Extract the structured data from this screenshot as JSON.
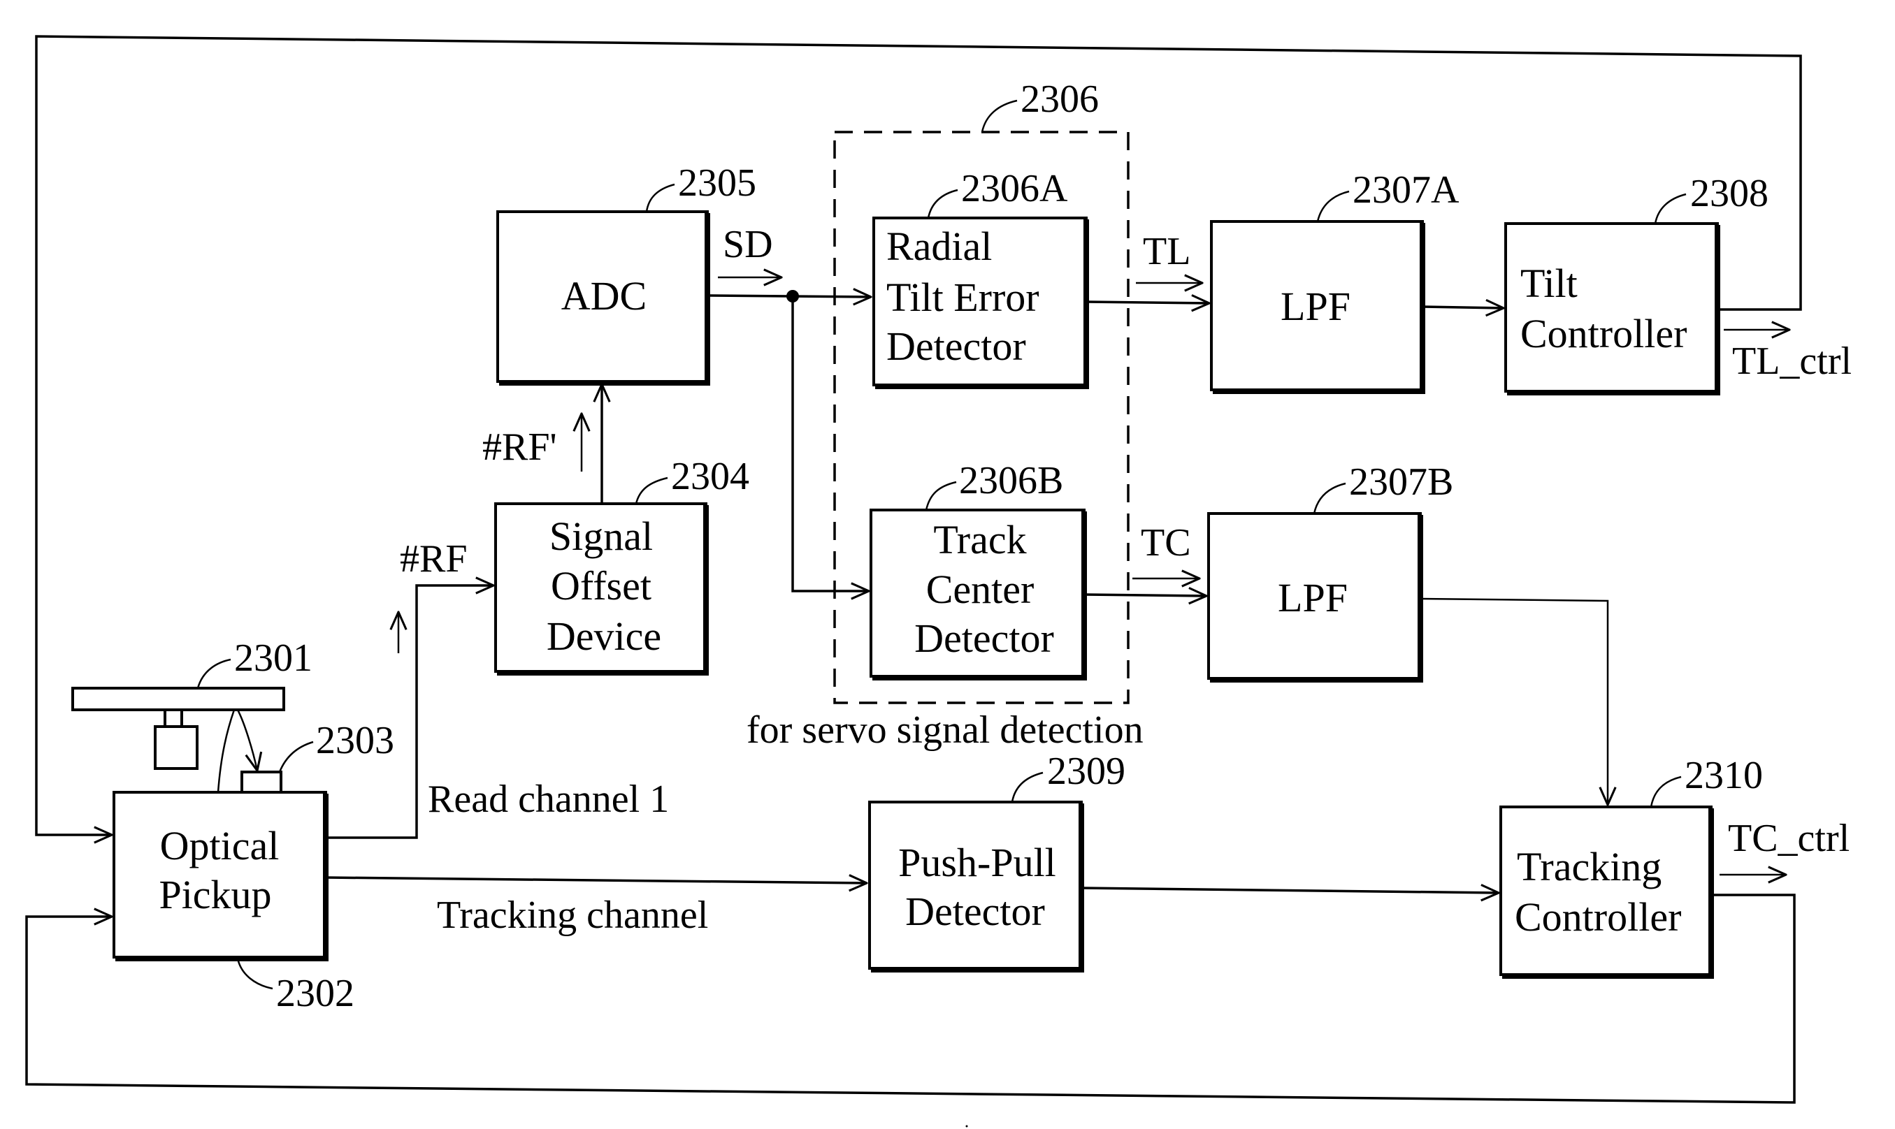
{
  "figure": {
    "blocks": {
      "optical_pickup": {
        "lines": [
          "Optical",
          "Pickup"
        ],
        "ref": "2302"
      },
      "disc": {
        "ref": "2301"
      },
      "sensor": {
        "ref": "2303"
      },
      "signal_offset": {
        "lines": [
          "Signal",
          "Offset",
          "Device"
        ],
        "ref": "2304"
      },
      "adc": {
        "lines": [
          "ADC"
        ],
        "ref": "2305"
      },
      "servo_group": {
        "ref": "2306",
        "caption": "for servo signal detection"
      },
      "radial_tilt": {
        "lines": [
          "Radial",
          "Tilt Error",
          "Detector"
        ],
        "ref": "2306A"
      },
      "track_center": {
        "lines": [
          "Track",
          "Center",
          "Detector"
        ],
        "ref": "2306B"
      },
      "lpf_a": {
        "lines": [
          "LPF"
        ],
        "ref": "2307A"
      },
      "lpf_b": {
        "lines": [
          "LPF"
        ],
        "ref": "2307B"
      },
      "tilt_controller": {
        "lines": [
          "Tilt",
          "Controller"
        ],
        "ref": "2308"
      },
      "push_pull": {
        "lines": [
          "Push-Pull",
          "Detector"
        ],
        "ref": "2309"
      },
      "tracking_controller": {
        "lines": [
          "Tracking",
          "Controller"
        ],
        "ref": "2310"
      }
    },
    "signals": {
      "sd": "SD",
      "rf": "#RF",
      "rf_prime": "#RF'",
      "tl": "TL",
      "tc": "TC",
      "tl_ctrl": "TL_ctrl",
      "tc_ctrl": "TC_ctrl",
      "read_channel": "Read channel 1",
      "tracking_channel": "Tracking channel"
    }
  }
}
